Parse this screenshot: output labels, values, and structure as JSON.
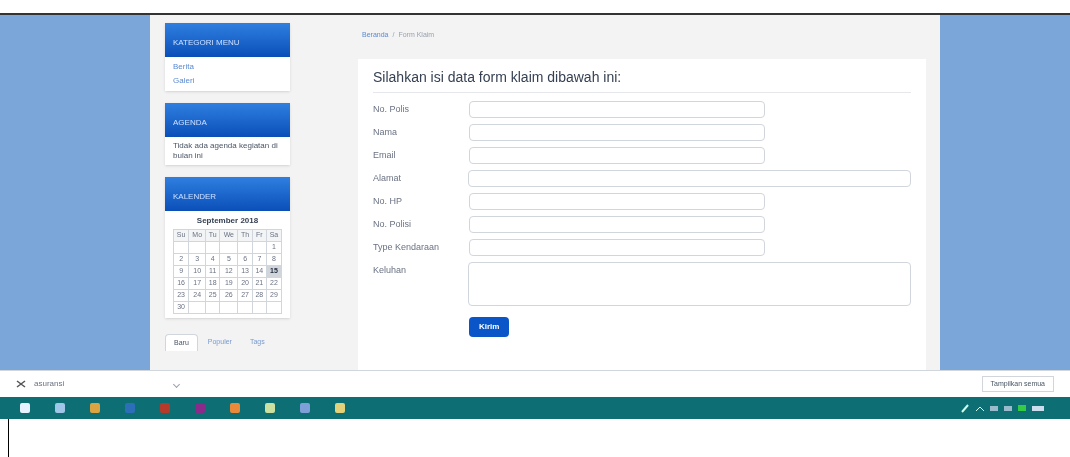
{
  "sidebar": {
    "menu": {
      "title": "KATEGORI MENU",
      "links": [
        "Berita",
        "Galeri"
      ]
    },
    "agenda": {
      "title": "AGENDA",
      "text": "Tidak ada agenda kegiatan di bulan ini"
    },
    "calendar": {
      "title": "KALENDER",
      "month": "September 2018",
      "weekdays": [
        "Su",
        "Mo",
        "Tu",
        "We",
        "Th",
        "Fr",
        "Sa"
      ],
      "weeks": [
        [
          {
            "day": "1",
            "selected": false
          }
        ],
        [
          {
            "day": "2",
            "selected": false
          },
          {
            "day": "3",
            "selected": false
          },
          {
            "day": "4",
            "selected": false
          },
          {
            "day": "5",
            "selected": false
          },
          {
            "day": "6",
            "selected": false
          },
          {
            "day": "7",
            "selected": false
          },
          {
            "day": "8",
            "selected": false
          }
        ],
        [
          {
            "day": "9",
            "selected": false
          },
          {
            "day": "10",
            "selected": false
          },
          {
            "day": "11",
            "selected": false
          },
          {
            "day": "12",
            "selected": false
          },
          {
            "day": "13",
            "selected": false
          },
          {
            "day": "14",
            "selected": false
          },
          {
            "day": "15",
            "selected": true
          }
        ],
        [
          {
            "day": "16",
            "selected": false
          },
          {
            "day": "17",
            "selected": false
          },
          {
            "day": "18",
            "selected": false
          },
          {
            "day": "19",
            "selected": false
          },
          {
            "day": "20",
            "selected": false
          },
          {
            "day": "21",
            "selected": false
          },
          {
            "day": "22",
            "selected": false
          }
        ],
        [
          {
            "day": "23",
            "selected": false
          },
          {
            "day": "24",
            "selected": false
          },
          {
            "day": "25",
            "selected": false
          },
          {
            "day": "26",
            "selected": false
          },
          {
            "day": "27",
            "selected": false
          },
          {
            "day": "28",
            "selected": false
          },
          {
            "day": "29",
            "selected": false
          }
        ],
        [
          {
            "day": "30",
            "selected": false
          }
        ]
      ]
    },
    "tabs": [
      {
        "label": "Baru",
        "selected": true
      },
      {
        "label": "Populer",
        "selected": false
      },
      {
        "label": "Tags",
        "selected": false
      }
    ]
  },
  "breadcrumb": {
    "separator": "/",
    "items": [
      "Beranda",
      "Form Klaim"
    ]
  },
  "form": {
    "title": "Silahkan isi data form klaim dibawah ini:",
    "fields": [
      {
        "label": "No. Polis",
        "kind": "short"
      },
      {
        "label": "Nama",
        "kind": "short"
      },
      {
        "label": "Email",
        "kind": "short"
      },
      {
        "label": "Alamat",
        "kind": "long"
      },
      {
        "label": "No. HP",
        "kind": "short"
      },
      {
        "label": "No. Polisi",
        "kind": "short"
      },
      {
        "label": "Type Kendaraan",
        "kind": "short"
      },
      {
        "label": "Keluhan",
        "kind": "area"
      }
    ],
    "submit": "Kirim"
  },
  "downloads": {
    "file": "asuransi",
    "show_all": "Tampilkan semua"
  }
}
